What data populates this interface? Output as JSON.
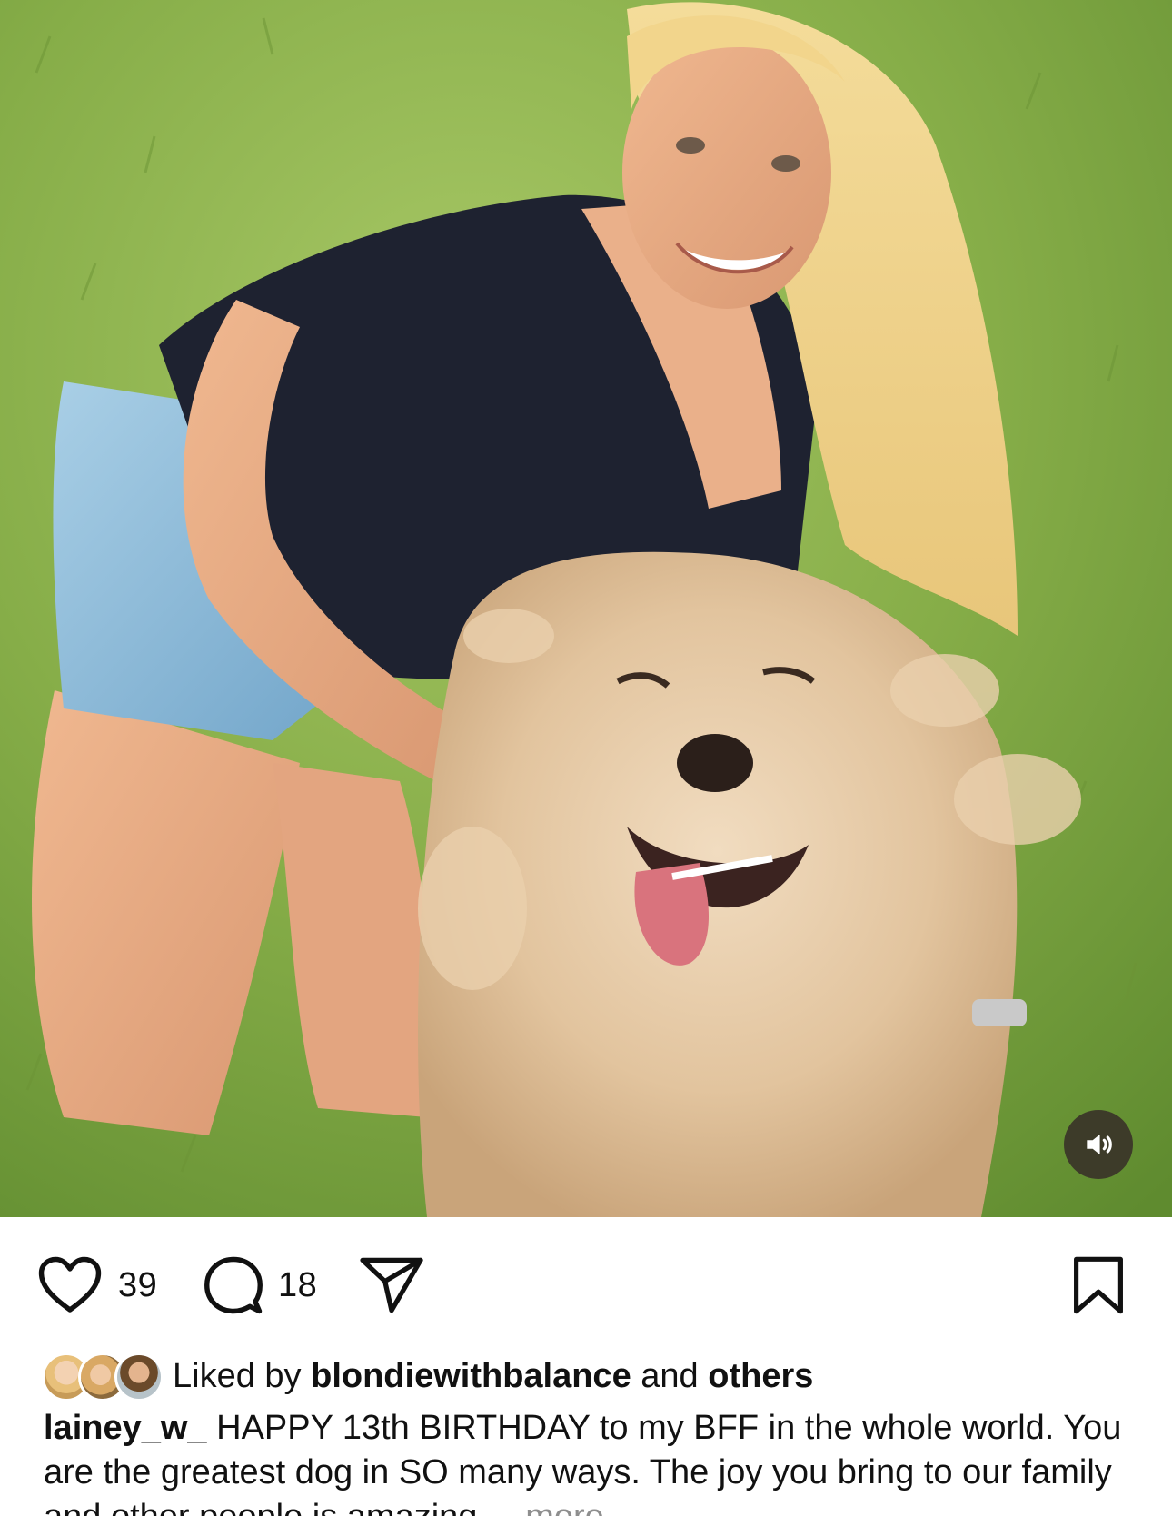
{
  "post": {
    "media": {
      "description_icon": "volume-icon",
      "sound_state": "on"
    },
    "actions": {
      "like_count": "39",
      "comment_count": "18",
      "like_icon": "heart-icon",
      "comment_icon": "comment-bubble-icon",
      "share_icon": "paper-plane-icon",
      "save_icon": "bookmark-icon"
    },
    "liked_by": {
      "prefix": "Liked by",
      "user": "blondiewithbalance",
      "conjunction": "and",
      "others": "others"
    },
    "caption": {
      "username": "lainey_w_",
      "text": "HAPPY 13th BIRTHDAY to my BFF in the whole world. You are the greatest dog in SO many ways. The joy you bring to our family and other people is amazing",
      "more_label": "... more"
    }
  }
}
